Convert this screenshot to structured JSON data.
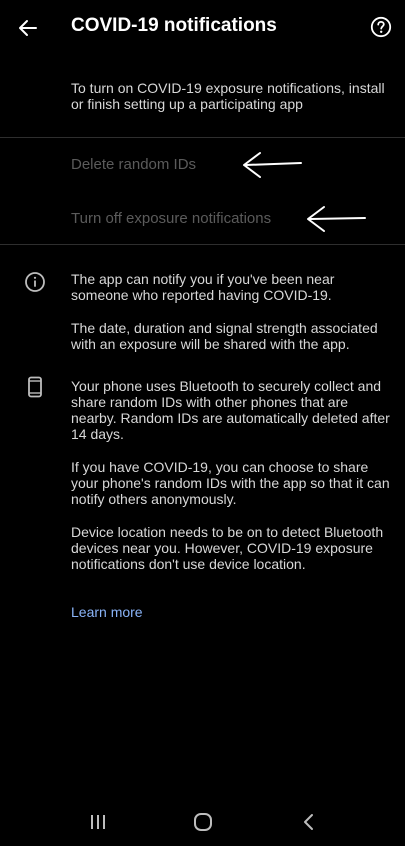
{
  "header": {
    "title": "COVID-19 notifications",
    "back_icon": "arrow-left-icon",
    "help_icon": "help-circle-icon"
  },
  "intro": {
    "text": "To turn on COVID-19 exposure notifications, install or finish setting up a participating app"
  },
  "menu": {
    "items": [
      {
        "label": "Delete random IDs"
      },
      {
        "label": "Turn off exposure notifications"
      }
    ]
  },
  "info": {
    "section1": {
      "icon": "info-icon",
      "paragraphs": [
        "The app can notify you if you've been near someone who reported having COVID-19.",
        "The date, duration and signal strength associated with an exposure will be shared with the app."
      ]
    },
    "section2": {
      "icon": "phone-icon",
      "paragraphs": [
        "Your phone uses Bluetooth to securely collect and share random IDs with other phones that are nearby. Random IDs are automatically deleted after 14 days.",
        "If you have COVID-19, you can choose to share your phone's random IDs with the app so that it can notify others anonymously.",
        "Device location needs to be on to detect Bluetooth devices near you. However, COVID-19 exposure notifications don't use device location."
      ]
    }
  },
  "learn_more": {
    "label": "Learn more"
  },
  "colors": {
    "background": "#000000",
    "text_primary": "#ffffff",
    "text_secondary": "#d8d8d8",
    "text_disabled": "#5b5b5b",
    "link": "#8ab4f8"
  },
  "navbar": {
    "recents_icon": "recents-icon",
    "home_icon": "home-icon",
    "back_icon": "nav-back-icon"
  }
}
